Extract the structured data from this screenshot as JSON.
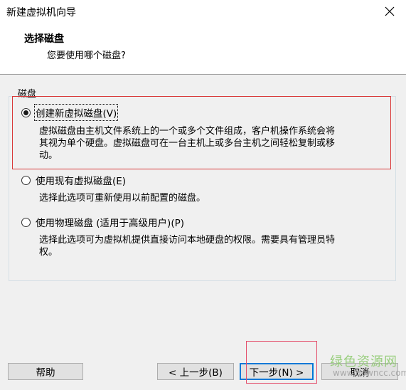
{
  "window": {
    "title": "新建虚拟机向导"
  },
  "header": {
    "title": "选择磁盘",
    "subtitle": "您要使用哪个磁盘?"
  },
  "group": {
    "label": "磁盘"
  },
  "options": [
    {
      "label": "创建新虚拟磁盘(V)",
      "selected": true,
      "description_lines": [
        "虚拟磁盘由主机文件系统上的一个或多个文件组成，客户机操作系统会将",
        "其视为单个硬盘。虚拟磁盘可在一台主机上或多台主机之间轻松复制或移",
        "动。"
      ]
    },
    {
      "label": "使用现有虚拟磁盘(E)",
      "selected": false,
      "description_lines": [
        "选择此选项可重新使用以前配置的磁盘。"
      ]
    },
    {
      "label": "使用物理磁盘 (适用于高级用户)(P)",
      "selected": false,
      "description_lines": [
        "选择此选项可为虚拟机提供直接访问本地硬盘的权限。需要具有管理员特",
        "权。"
      ]
    }
  ],
  "buttons": {
    "help": "帮助",
    "back": "< 上一步(B)",
    "next": "下一步(N) >",
    "cancel": "取消"
  },
  "watermark": {
    "brand": "绿色资源网",
    "site": "www.downcc.com"
  },
  "colors": {
    "annotation_red": "#d93838",
    "default_button_border": "#0078d7"
  }
}
